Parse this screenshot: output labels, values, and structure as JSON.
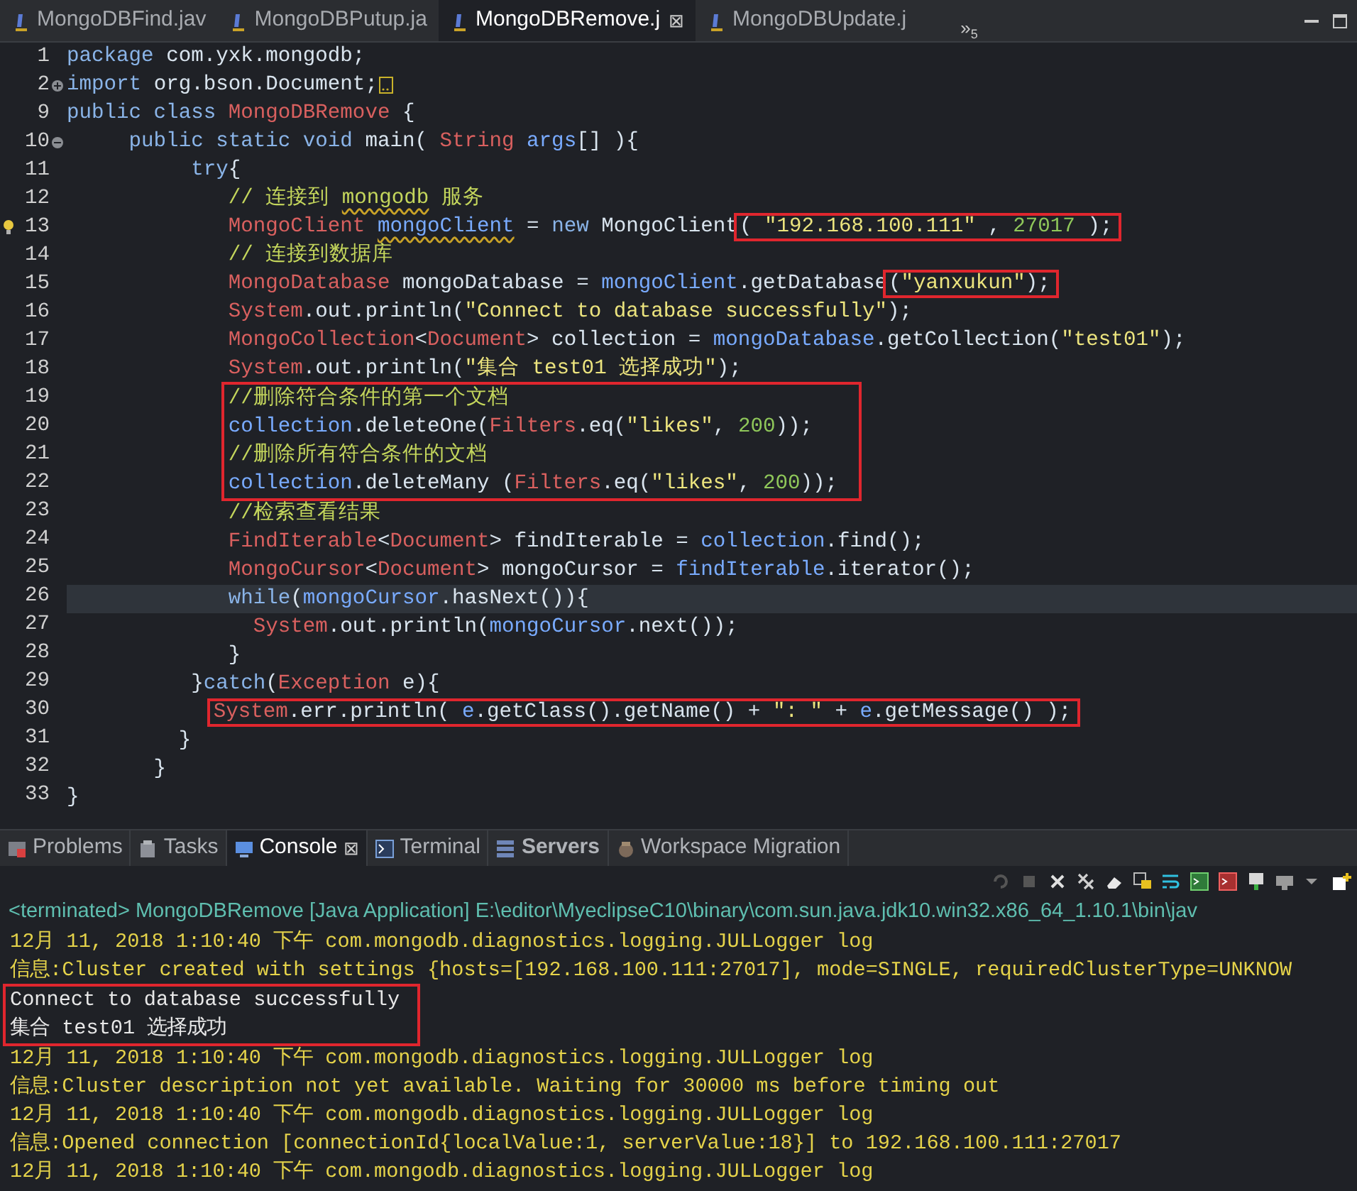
{
  "editor_tabs": [
    {
      "label": "MongoDBFind.jav",
      "selected": false
    },
    {
      "label": "MongoDBPutup.ja",
      "selected": false
    },
    {
      "label": "MongoDBRemove.j",
      "selected": true,
      "close": "⊠"
    },
    {
      "label": "MongoDBUpdate.j",
      "selected": false
    }
  ],
  "overflow": {
    "chevron": "»",
    "count": "5"
  },
  "code": [
    {
      "kind": "line",
      "number": "1",
      "current": false,
      "code": [
        {
          "kind": "kw",
          "text": "package "
        },
        {
          "kind": "plain",
          "text": "com.yxk.mongodb;"
        }
      ]
    },
    {
      "kind": "line",
      "number": "2",
      "current": false,
      "collapsed": true,
      "code": [
        {
          "kind": "kw",
          "text": "import "
        },
        {
          "kind": "plain",
          "text": "org.bson.Document;"
        }
      ]
    },
    {
      "kind": "line",
      "number": "9",
      "current": false,
      "code": [
        {
          "kind": "kw",
          "text": "public class "
        },
        {
          "kind": "type",
          "text": "MongoDBRemove"
        },
        {
          "kind": "plain",
          "text": " {"
        }
      ]
    },
    {
      "kind": "line",
      "number": "10",
      "current": false,
      "collapsed": false,
      "code": [
        {
          "kind": "kw",
          "text": "     public static void "
        },
        {
          "kind": "plain",
          "text": "main( "
        },
        {
          "kind": "type",
          "text": "String "
        },
        {
          "kind": "var",
          "text": "args"
        },
        {
          "kind": "plain",
          "text": "[] ){"
        }
      ]
    },
    {
      "kind": "line",
      "number": "11",
      "current": false,
      "code": [
        {
          "kind": "kw",
          "text": "          try"
        },
        {
          "kind": "plain",
          "text": "{"
        }
      ]
    },
    {
      "kind": "line",
      "number": "12",
      "current": false,
      "code": [
        {
          "kind": "com",
          "text": "             // 连接到 "
        },
        {
          "kind": "com",
          "text": "mongodb",
          "warn": true
        },
        {
          "kind": "com",
          "text": " 服务"
        }
      ]
    },
    {
      "kind": "line",
      "number": "13",
      "current": false,
      "quick_fix": true,
      "code": [
        {
          "kind": "type",
          "text": "             MongoClient "
        },
        {
          "kind": "var",
          "text": "mongoClient",
          "warn": true
        },
        {
          "kind": "plain",
          "text": " = "
        },
        {
          "kind": "kw",
          "text": "new "
        },
        {
          "kind": "plain",
          "text": "MongoClient"
        }
      ],
      "boxed_code": [
        {
          "kind": "plain",
          "text": "( "
        },
        {
          "kind": "str",
          "text": "\"192.168.100.111\""
        },
        {
          "kind": "plain",
          "text": " , "
        },
        {
          "kind": "num",
          "text": "27017"
        },
        {
          "kind": "plain",
          "text": " );"
        }
      ]
    },
    {
      "kind": "line",
      "number": "14",
      "current": false,
      "code": [
        {
          "kind": "com",
          "text": "             // 连接到数据库"
        }
      ]
    },
    {
      "kind": "line",
      "number": "15",
      "current": false,
      "code": [
        {
          "kind": "type",
          "text": "             MongoDatabase"
        },
        {
          "kind": "plain",
          "text": " mongoDatabase = "
        },
        {
          "kind": "var",
          "text": "mongoClient"
        },
        {
          "kind": "plain",
          "text": ".getDatabase"
        }
      ],
      "boxed_code": [
        {
          "kind": "plain",
          "text": "("
        },
        {
          "kind": "str",
          "text": "\"yanxukun\""
        },
        {
          "kind": "plain",
          "text": ");"
        }
      ]
    },
    {
      "kind": "line",
      "number": "16",
      "current": false,
      "code": [
        {
          "kind": "type",
          "text": "             System"
        },
        {
          "kind": "plain",
          "text": ".out.println("
        },
        {
          "kind": "str",
          "text": "\"Connect to database successfully\""
        },
        {
          "kind": "plain",
          "text": ");"
        }
      ]
    },
    {
      "kind": "line",
      "number": "17",
      "current": false,
      "code": [
        {
          "kind": "type",
          "text": "             MongoCollection"
        },
        {
          "kind": "plain",
          "text": "<"
        },
        {
          "kind": "type",
          "text": "Document"
        },
        {
          "kind": "plain",
          "text": "> collection = "
        },
        {
          "kind": "var",
          "text": "mongoDatabase"
        },
        {
          "kind": "plain",
          "text": ".getCollection("
        },
        {
          "kind": "str",
          "text": "\"test01\""
        },
        {
          "kind": "plain",
          "text": ");"
        }
      ]
    },
    {
      "kind": "line",
      "number": "18",
      "current": false,
      "code": [
        {
          "kind": "type",
          "text": "             System"
        },
        {
          "kind": "plain",
          "text": ".out.println("
        },
        {
          "kind": "str",
          "text": "\"集合 test01 选择成功\""
        },
        {
          "kind": "plain",
          "text": ");"
        }
      ]
    },
    {
      "kind": "box_group",
      "lines": [
        {
          "number": "19",
          "current": false,
          "code": [
            {
              "kind": "com",
              "text": "//删除符合条件的第一个文档"
            }
          ]
        },
        {
          "number": "20",
          "current": false,
          "code": [
            {
              "kind": "var",
              "text": "collection"
            },
            {
              "kind": "plain",
              "text": ".deleteOne("
            },
            {
              "kind": "type",
              "text": "Filters"
            },
            {
              "kind": "plain",
              "text": ".eq("
            },
            {
              "kind": "str",
              "text": "\"likes\""
            },
            {
              "kind": "plain",
              "text": ", "
            },
            {
              "kind": "num",
              "text": "200"
            },
            {
              "kind": "plain",
              "text": "));"
            }
          ]
        },
        {
          "number": "21",
          "current": false,
          "code": [
            {
              "kind": "com",
              "text": "//删除所有符合条件的文档"
            }
          ]
        },
        {
          "number": "22",
          "current": false,
          "code": [
            {
              "kind": "var",
              "text": "collection"
            },
            {
              "kind": "plain",
              "text": ".deleteMany ("
            },
            {
              "kind": "type",
              "text": "Filters"
            },
            {
              "kind": "plain",
              "text": ".eq("
            },
            {
              "kind": "str",
              "text": "\"likes\""
            },
            {
              "kind": "plain",
              "text": ", "
            },
            {
              "kind": "num",
              "text": "200"
            },
            {
              "kind": "plain",
              "text": "));"
            }
          ]
        }
      ]
    },
    {
      "kind": "line",
      "number": "23",
      "current": false,
      "code": [
        {
          "kind": "com",
          "text": "             //检索查看结果"
        }
      ]
    },
    {
      "kind": "line",
      "number": "24",
      "current": false,
      "code": [
        {
          "kind": "type",
          "text": "             FindIterable"
        },
        {
          "kind": "plain",
          "text": "<"
        },
        {
          "kind": "type",
          "text": "Document"
        },
        {
          "kind": "plain",
          "text": "> findIterable = "
        },
        {
          "kind": "var",
          "text": "collection"
        },
        {
          "kind": "plain",
          "text": ".find();"
        }
      ]
    },
    {
      "kind": "line",
      "number": "25",
      "current": false,
      "code": [
        {
          "kind": "type",
          "text": "             MongoCursor"
        },
        {
          "kind": "plain",
          "text": "<"
        },
        {
          "kind": "type",
          "text": "Document"
        },
        {
          "kind": "plain",
          "text": "> mongoCursor = "
        },
        {
          "kind": "var",
          "text": "findIterable"
        },
        {
          "kind": "plain",
          "text": ".iterator();"
        }
      ]
    },
    {
      "kind": "line",
      "number": "26",
      "current": true,
      "code": [
        {
          "kind": "kw",
          "text": "             while"
        },
        {
          "kind": "plain",
          "text": "("
        },
        {
          "kind": "var",
          "text": "mongoCursor"
        },
        {
          "kind": "plain",
          "text": ".hasNext()){"
        }
      ]
    },
    {
      "kind": "line",
      "number": "27",
      "current": false,
      "code": [
        {
          "kind": "type",
          "text": "               System"
        },
        {
          "kind": "plain",
          "text": ".out.println("
        },
        {
          "kind": "var",
          "text": "mongoCursor"
        },
        {
          "kind": "plain",
          "text": ".next());"
        }
      ]
    },
    {
      "kind": "line",
      "number": "28",
      "current": false,
      "code": [
        {
          "kind": "plain",
          "text": "             }"
        }
      ]
    },
    {
      "kind": "line",
      "number": "29",
      "current": false,
      "code": [
        {
          "kind": "plain",
          "text": "          }"
        },
        {
          "kind": "kw",
          "text": "catch"
        },
        {
          "kind": "plain",
          "text": "("
        },
        {
          "kind": "type",
          "text": "Exception"
        },
        {
          "kind": "plain",
          "text": " e){"
        }
      ]
    },
    {
      "kind": "line",
      "number": "30",
      "current": false,
      "boxed_code": [
        {
          "kind": "type",
          "text": "System"
        },
        {
          "kind": "plain",
          "text": ".err.println( "
        },
        {
          "kind": "var",
          "text": "e"
        },
        {
          "kind": "plain",
          "text": ".getClass().getName() + "
        },
        {
          "kind": "str",
          "text": "\": \""
        },
        {
          "kind": "plain",
          "text": " + "
        },
        {
          "kind": "var",
          "text": "e"
        },
        {
          "kind": "plain",
          "text": ".getMessage() );"
        }
      ]
    },
    {
      "kind": "line",
      "number": "31",
      "current": false,
      "code": [
        {
          "kind": "plain",
          "text": "         }"
        }
      ]
    },
    {
      "kind": "line",
      "number": "32",
      "current": false,
      "code": [
        {
          "kind": "plain",
          "text": "       }"
        }
      ]
    },
    {
      "kind": "line",
      "number": "33",
      "current": false,
      "code": [
        {
          "kind": "plain",
          "text": "}"
        }
      ]
    }
  ],
  "console_tabs": [
    {
      "label": "Problems",
      "selected": false,
      "bold": false
    },
    {
      "label": "Tasks",
      "selected": false,
      "bold": false
    },
    {
      "label": "Console",
      "selected": true,
      "bold": false,
      "close": "⊠"
    },
    {
      "label": "Terminal",
      "selected": false,
      "bold": false
    },
    {
      "label": "Servers",
      "selected": false,
      "bold": true
    },
    {
      "label": "Workspace Migration",
      "selected": false,
      "bold": false
    }
  ],
  "console_header": "<terminated> MongoDBRemove [Java Application] E:\\editor\\MyeclipseC10\\binary\\com.sun.java.jdk10.win32.x86_64_1.10.1\\bin\\jav",
  "console": [
    {
      "kind": "line",
      "stderr": true,
      "text": "12月 11, 2018 1:10:40 下午 com.mongodb.diagnostics.logging.JULLogger log"
    },
    {
      "kind": "line",
      "stderr": true,
      "text": "信息:Cluster created with settings {hosts=[192.168.100.111:27017], mode=SINGLE, requiredClusterType=UNKNOW"
    },
    {
      "kind": "box_group",
      "lines": [
        {
          "stderr": false,
          "text": "Connect to database successfully"
        },
        {
          "stderr": false,
          "text": "集合 test01 选择成功"
        }
      ]
    },
    {
      "kind": "line",
      "stderr": true,
      "text": "12月 11, 2018 1:10:40 下午 com.mongodb.diagnostics.logging.JULLogger log"
    },
    {
      "kind": "line",
      "stderr": true,
      "text": "信息:Cluster description not yet available. Waiting for 30000 ms before timing out"
    },
    {
      "kind": "line",
      "stderr": true,
      "text": "12月 11, 2018 1:10:40 下午 com.mongodb.diagnostics.logging.JULLogger log"
    },
    {
      "kind": "line",
      "stderr": true,
      "text": "信息:Opened connection [connectionId{localValue:1, serverValue:18}] to 192.168.100.111:27017"
    },
    {
      "kind": "line",
      "stderr": true,
      "text": "12月 11, 2018 1:10:40 下午 com.mongodb.diagnostics.logging.JULLogger log"
    }
  ]
}
